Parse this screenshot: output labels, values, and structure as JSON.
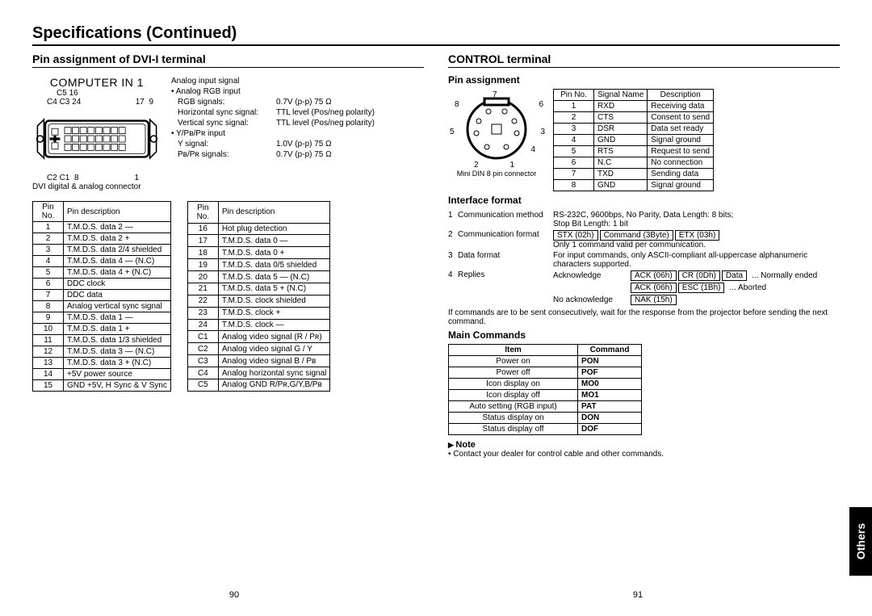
{
  "page_title": "Specifications (Continued)",
  "side_tab": "Others",
  "page_left": "90",
  "page_right": "91",
  "dvi": {
    "heading": "Pin assignment of DVI-I terminal",
    "connector_title": "COMPUTER IN 1",
    "connector_note": "DVI digital & analog connector",
    "labels": {
      "c5": "C5",
      "c4": "C4",
      "c3": "C3",
      "c2": "C2",
      "c1": "C1",
      "p16": "16",
      "p24": "24",
      "p17": "17",
      "p9": "9",
      "p8": "8",
      "p1": "1"
    },
    "signals": {
      "title": "Analog input signal",
      "row1_lbl": "• Analog RGB input",
      "row1a_k": "RGB signals:",
      "row1a_v": "0.7V (p-p) 75 Ω",
      "row1b_k": "Horizontal sync signal:",
      "row1b_v": "TTL level (Pos/neg polarity)",
      "row1c_k": "Vertical sync signal:",
      "row1c_v": "TTL level (Pos/neg polarity)",
      "row2_lbl": "• Y/Pʙ/Pʀ input",
      "row2a_k": "Y signal:",
      "row2a_v": "1.0V (p-p) 75 Ω",
      "row2b_k": "Pʙ/Pʀ signals:",
      "row2b_v": "0.7V (p-p) 75 Ω"
    },
    "col1_h1": "Pin No.",
    "col1_h2": "Pin description",
    "col2_h1": "Pin No.",
    "col2_h2": "Pin description",
    "t1": [
      [
        "1",
        "T.M.D.S. data 2 —"
      ],
      [
        "2",
        "T.M.D.S. data 2 +"
      ],
      [
        "3",
        "T.M.D.S. data 2/4 shielded"
      ],
      [
        "4",
        "T.M.D.S. data 4 — (N.C)"
      ],
      [
        "5",
        "T.M.D.S. data 4 + (N.C)"
      ],
      [
        "6",
        "DDC clock"
      ],
      [
        "7",
        "DDC data"
      ],
      [
        "8",
        "Analog vertical sync signal"
      ],
      [
        "9",
        "T.M.D.S. data 1 —"
      ],
      [
        "10",
        "T.M.D.S. data 1 +"
      ],
      [
        "11",
        "T.M.D.S. data 1/3 shielded"
      ],
      [
        "12",
        "T.M.D.S. data 3 — (N.C)"
      ],
      [
        "13",
        "T.M.D.S. data 3 + (N.C)"
      ],
      [
        "14",
        "+5V power source"
      ],
      [
        "15",
        "GND +5V, H Sync & V Sync"
      ]
    ],
    "t2": [
      [
        "16",
        "Hot plug detection"
      ],
      [
        "17",
        "T.M.D.S. data 0 —"
      ],
      [
        "18",
        "T.M.D.S. data 0 +"
      ],
      [
        "19",
        "T.M.D.S. data 0/5 shielded"
      ],
      [
        "20",
        "T.M.D.S. data 5 — (N.C)"
      ],
      [
        "21",
        "T.M.D.S. data 5 + (N.C)"
      ],
      [
        "22",
        "T.M.D.S. clock shielded"
      ],
      [
        "23",
        "T.M.D.S. clock +"
      ],
      [
        "24",
        "T.M.D.S. clock —"
      ],
      [
        "C1",
        "Analog video signal (R / Pʀ)"
      ],
      [
        "C2",
        "Analog video signal  G / Y"
      ],
      [
        "C3",
        "Analog video signal  B / Pʙ"
      ],
      [
        "C4",
        "Analog horizontal sync signal"
      ],
      [
        "C5",
        "Analog GND R/Pʀ,G/Y,B/Pʙ"
      ]
    ]
  },
  "ctrl": {
    "heading": "CONTROL terminal",
    "pin_hd": "Pin assignment",
    "din_label": "Mini DIN 8 pin connector",
    "pins": {
      "p1": "1",
      "p2": "2",
      "p3": "3",
      "p4": "4",
      "p5": "5",
      "p6": "6",
      "p7": "7",
      "p8": "8"
    },
    "tbl_h1": "Pin No.",
    "tbl_h2": "Signal Name",
    "tbl_h3": "Description",
    "tbl": [
      [
        "1",
        "RXD",
        "Receiving data"
      ],
      [
        "2",
        "CTS",
        "Consent to send"
      ],
      [
        "3",
        "DSR",
        "Data set ready"
      ],
      [
        "4",
        "GND",
        "Signal ground"
      ],
      [
        "5",
        "RTS",
        "Request to send"
      ],
      [
        "6",
        "N.C",
        "No connection"
      ],
      [
        "7",
        "TXD",
        "Sending data"
      ],
      [
        "8",
        "GND",
        "Signal ground"
      ]
    ],
    "intf_hd": "Interface format",
    "intf1_k": "Communication method",
    "intf1_v": "RS-232C, 9600bps, No Parity, Data Length: 8 bits;",
    "intf1_v2": "Stop Bit Length:        1 bit",
    "intf2_k": "Communication format",
    "intf2_b1": "STX (02h)",
    "intf2_b2": "Command (3Byte)",
    "intf2_b3": "ETX (03h)",
    "intf2_note": "Only 1 command valid per communication.",
    "intf3_k": "Data format",
    "intf3_v": "For input commands, only ASCII-compliant all-uppercase alphanumeric characters supported.",
    "intf4_k": "Replies",
    "intf4_ack": "Acknowledge",
    "intf4_b1": "ACK (06h)",
    "intf4_b2": "CR (0Dh)",
    "intf4_b3": "Data",
    "intf4_r1": "... Normally ended",
    "intf4_b4": "ACK (06h)",
    "intf4_b5": "ESC (1Bh)",
    "intf4_r2": "... Aborted",
    "intf4_nack": "No acknowledge",
    "intf4_b6": "NAK (15h)",
    "intf_foot": "If commands are to be sent consecutively, wait for the response from the projector before sending the next command.",
    "cmd_hd": "Main Commands",
    "cmd_h1": "Item",
    "cmd_h2": "Command",
    "cmd": [
      [
        "Power on",
        "PON"
      ],
      [
        "Power off",
        "POF"
      ],
      [
        "Icon display on",
        "MO0"
      ],
      [
        "Icon display off",
        "MO1"
      ],
      [
        "Auto setting (RGB input)",
        "PAT"
      ],
      [
        "Status display on",
        "DON"
      ],
      [
        "Status display off",
        "DOF"
      ]
    ],
    "note_hd": "Note",
    "note_txt": "Contact your dealer for control cable and other commands."
  }
}
